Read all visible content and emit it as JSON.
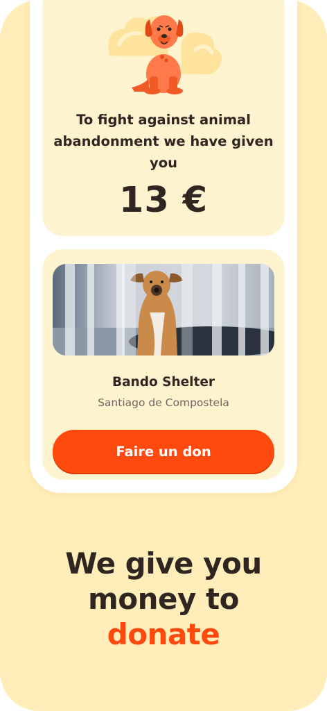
{
  "colors": {
    "background": "#ffeeb9",
    "card": "#fef3cf",
    "accent": "#fe4a0e",
    "text": "#2f2622",
    "muted": "#6f6762"
  },
  "hero": {
    "icon": "dog-mascot-icon",
    "message": "To fight against animal abandonment we have given you",
    "amount": "13 €"
  },
  "shelter": {
    "photo": "shelter-dog-photo",
    "name": "Bando Shelter",
    "location": "Santiago de Compostela",
    "cta_label": "Faire un don"
  },
  "tagline": {
    "line1": "We give you",
    "line2": "money to",
    "highlight": "donate"
  }
}
